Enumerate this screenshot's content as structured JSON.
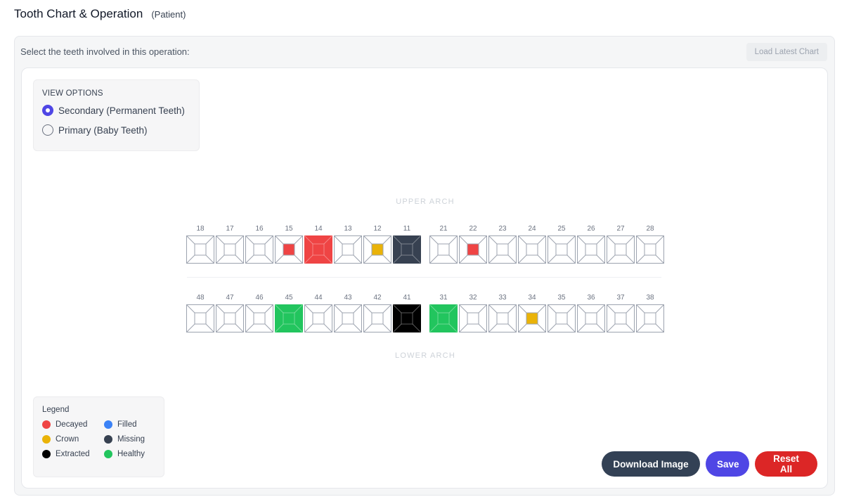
{
  "header": {
    "title": "Tooth Chart & Operation",
    "subtitle": "(Patient)"
  },
  "panel": {
    "instruction": "Select the teeth involved in this operation:",
    "load_button": "Load Latest Chart"
  },
  "view_options": {
    "title": "VIEW OPTIONS",
    "options": [
      {
        "label": "Secondary (Permanent Teeth)",
        "selected": true
      },
      {
        "label": "Primary (Baby Teeth)",
        "selected": false
      }
    ]
  },
  "arches": {
    "upper_label": "UPPER ARCH",
    "lower_label": "LOWER ARCH"
  },
  "colors": {
    "decayed": "#ef4444",
    "filled": "#3b82f6",
    "crown": "#eab308",
    "missing": "#374151",
    "extracted": "#000000",
    "healthy": "#22c55e",
    "outline": "#9ca3af"
  },
  "upper_teeth": [
    {
      "num": "18",
      "state": "none",
      "scope": "none"
    },
    {
      "num": "17",
      "state": "none",
      "scope": "none"
    },
    {
      "num": "16",
      "state": "none",
      "scope": "none"
    },
    {
      "num": "15",
      "state": "decayed",
      "scope": "center"
    },
    {
      "num": "14",
      "state": "decayed",
      "scope": "whole"
    },
    {
      "num": "13",
      "state": "none",
      "scope": "none"
    },
    {
      "num": "12",
      "state": "crown",
      "scope": "center"
    },
    {
      "num": "11",
      "state": "missing",
      "scope": "whole"
    },
    {
      "num": "21",
      "state": "none",
      "scope": "none"
    },
    {
      "num": "22",
      "state": "decayed",
      "scope": "center"
    },
    {
      "num": "23",
      "state": "none",
      "scope": "none"
    },
    {
      "num": "24",
      "state": "none",
      "scope": "none"
    },
    {
      "num": "25",
      "state": "none",
      "scope": "none"
    },
    {
      "num": "26",
      "state": "none",
      "scope": "none"
    },
    {
      "num": "27",
      "state": "none",
      "scope": "none"
    },
    {
      "num": "28",
      "state": "none",
      "scope": "none"
    }
  ],
  "lower_teeth": [
    {
      "num": "48",
      "state": "none",
      "scope": "none"
    },
    {
      "num": "47",
      "state": "none",
      "scope": "none"
    },
    {
      "num": "46",
      "state": "none",
      "scope": "none"
    },
    {
      "num": "45",
      "state": "healthy",
      "scope": "whole"
    },
    {
      "num": "44",
      "state": "none",
      "scope": "none"
    },
    {
      "num": "43",
      "state": "none",
      "scope": "none"
    },
    {
      "num": "42",
      "state": "none",
      "scope": "none"
    },
    {
      "num": "41",
      "state": "extracted",
      "scope": "whole"
    },
    {
      "num": "31",
      "state": "healthy",
      "scope": "whole"
    },
    {
      "num": "32",
      "state": "none",
      "scope": "none"
    },
    {
      "num": "33",
      "state": "none",
      "scope": "none"
    },
    {
      "num": "34",
      "state": "crown",
      "scope": "center"
    },
    {
      "num": "35",
      "state": "none",
      "scope": "none"
    },
    {
      "num": "36",
      "state": "none",
      "scope": "none"
    },
    {
      "num": "37",
      "state": "none",
      "scope": "none"
    },
    {
      "num": "38",
      "state": "none",
      "scope": "none"
    }
  ],
  "legend": {
    "title": "Legend",
    "items": [
      {
        "label": "Decayed",
        "color": "#ef4444"
      },
      {
        "label": "Filled",
        "color": "#3b82f6"
      },
      {
        "label": "Crown",
        "color": "#eab308"
      },
      {
        "label": "Missing",
        "color": "#374151"
      },
      {
        "label": "Extracted",
        "color": "#000000"
      },
      {
        "label": "Healthy",
        "color": "#22c55e"
      }
    ]
  },
  "actions": {
    "download": "Download Image",
    "save": "Save",
    "reset": "Reset All"
  }
}
